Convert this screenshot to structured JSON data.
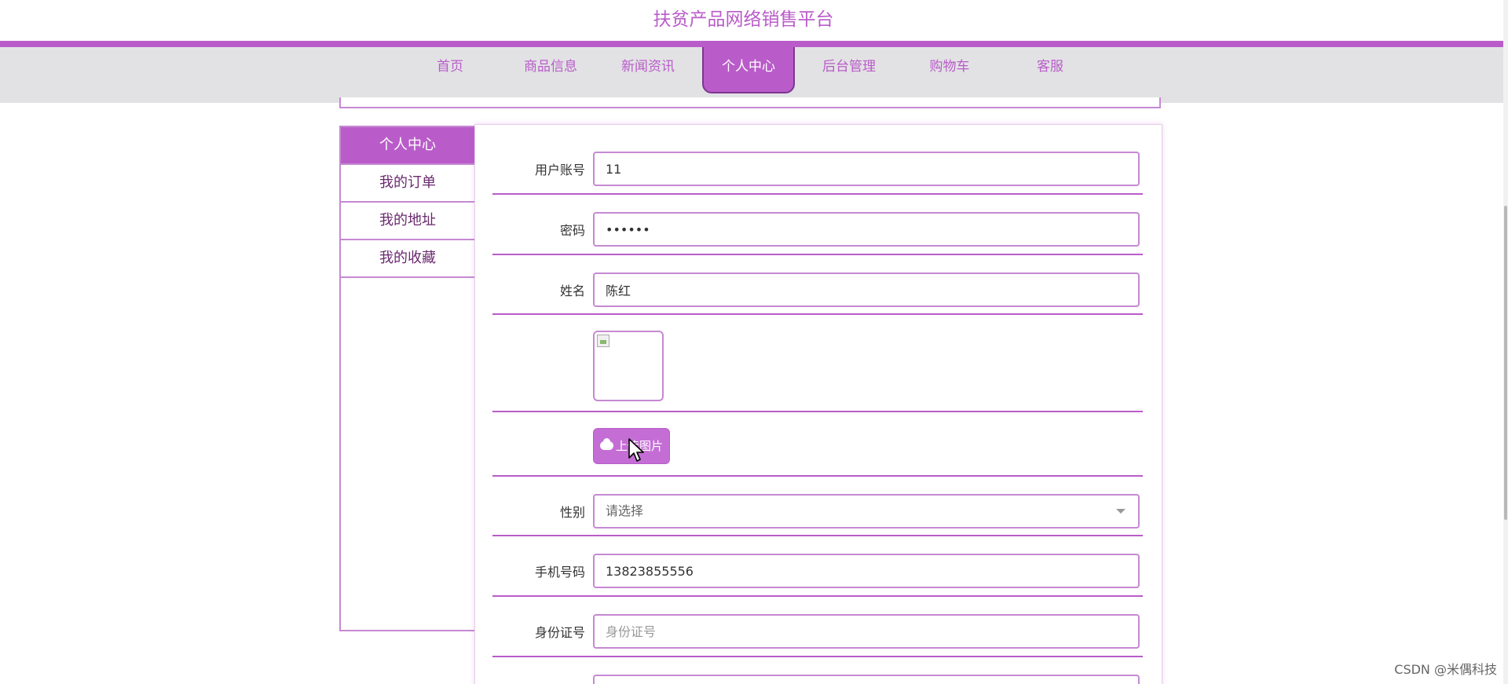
{
  "site": {
    "title": "扶贫产品网络销售平台"
  },
  "nav": {
    "items": [
      {
        "label": "首页"
      },
      {
        "label": "商品信息"
      },
      {
        "label": "新闻资讯"
      },
      {
        "label": "个人中心"
      },
      {
        "label": "后台管理"
      },
      {
        "label": "购物车"
      },
      {
        "label": "客服"
      }
    ],
    "active": "个人中心"
  },
  "sidebar": {
    "items": [
      {
        "label": "个人中心"
      },
      {
        "label": "我的订单"
      },
      {
        "label": "我的地址"
      },
      {
        "label": "我的收藏"
      }
    ],
    "active": "个人中心"
  },
  "form": {
    "username": {
      "label": "用户账号",
      "value": "11"
    },
    "password": {
      "label": "密码",
      "value": "••••••"
    },
    "name": {
      "label": "姓名",
      "value": "陈红"
    },
    "upload": {
      "label": "上传图片"
    },
    "gender": {
      "label": "性别",
      "placeholder": "请选择"
    },
    "phone": {
      "label": "手机号码",
      "value": "13823855556"
    },
    "idcard": {
      "label": "身份证号",
      "placeholder": "身份证号"
    }
  },
  "watermark": "CSDN @米偶科技",
  "colors": {
    "accent": "#b95cc9",
    "nav_bg": "#e2e2e4"
  },
  "icons": {
    "upload": "cloud-upload-icon",
    "cursor": "mouse-cursor-icon",
    "select": "chevron-down-icon"
  }
}
